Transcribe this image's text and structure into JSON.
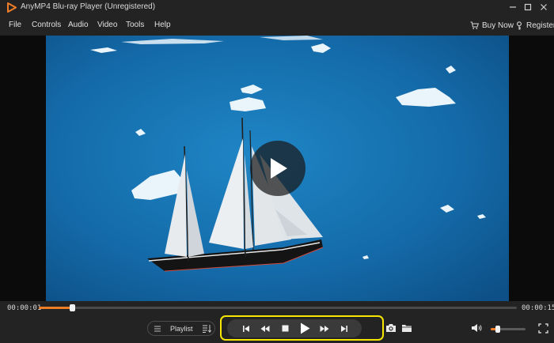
{
  "window": {
    "title": "AnyMP4 Blu-ray Player (Unregistered)",
    "logo_icon": "play-triangle-logo",
    "controls": [
      "minimize-icon",
      "maximize-icon",
      "close-icon"
    ]
  },
  "menu": {
    "items": [
      "File",
      "Controls",
      "Audio",
      "Video",
      "Tools",
      "Help"
    ],
    "buy_now": "Buy Now",
    "register": "Register"
  },
  "player": {
    "elapsed": "00:00:01",
    "duration": "00:00:15",
    "progress_fraction": 0.07,
    "volume_fraction": 0.2,
    "playlist_label": "Playlist",
    "state": "paused"
  },
  "colors": {
    "accent": "#f07d28",
    "highlight": "#f5e500",
    "background": "#1c1c1c"
  }
}
